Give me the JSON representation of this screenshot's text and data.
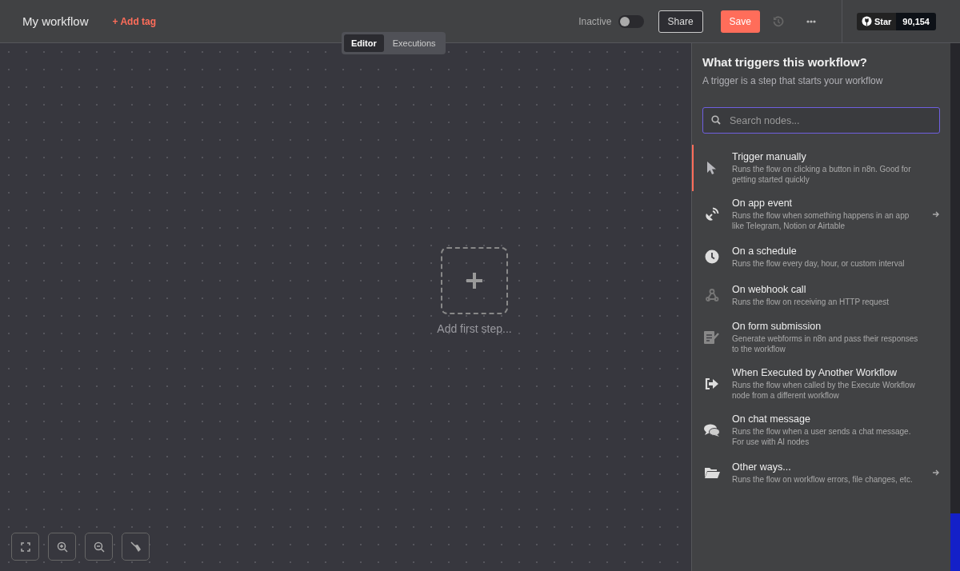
{
  "header": {
    "title": "My workflow",
    "add_tag": "+ Add tag",
    "toggle_label": "Inactive",
    "active": false,
    "share": "Share",
    "save": "Save",
    "star_label": "Star",
    "star_count": "90,154"
  },
  "view_tabs": [
    {
      "label": "Editor",
      "selected": true
    },
    {
      "label": "Executions",
      "selected": false
    }
  ],
  "canvas": {
    "add_step": "Add first step..."
  },
  "panel": {
    "title": "What triggers this workflow?",
    "subtitle": "A trigger is a step that starts your workflow",
    "search": {
      "placeholder": "Search nodes..."
    },
    "items": [
      {
        "title": "Trigger manually",
        "description": "Runs the flow on clicking a button in n8n. Good for getting started quickly",
        "selected": true,
        "submenu": false
      },
      {
        "title": "On app event",
        "description": "Runs the flow when something happens in an app like Telegram, Notion or Airtable",
        "selected": false,
        "submenu": true
      },
      {
        "title": "On a schedule",
        "description": "Runs the flow every day, hour, or custom interval",
        "selected": false,
        "submenu": false
      },
      {
        "title": "On webhook call",
        "description": "Runs the flow on receiving an HTTP request",
        "selected": false,
        "submenu": false
      },
      {
        "title": "On form submission",
        "description": "Generate webforms in n8n and pass their responses to the workflow",
        "selected": false,
        "submenu": false
      },
      {
        "title": "When Executed by Another Workflow",
        "description": "Runs the flow when called by the Execute Workflow node from a different workflow",
        "selected": false,
        "submenu": false
      },
      {
        "title": "On chat message",
        "description": "Runs the flow when a user sends a chat message. For use with AI nodes",
        "selected": false,
        "submenu": false
      },
      {
        "title": "Other ways...",
        "description": "Runs the flow on workflow errors, file changes, etc.",
        "selected": false,
        "submenu": true
      }
    ]
  }
}
